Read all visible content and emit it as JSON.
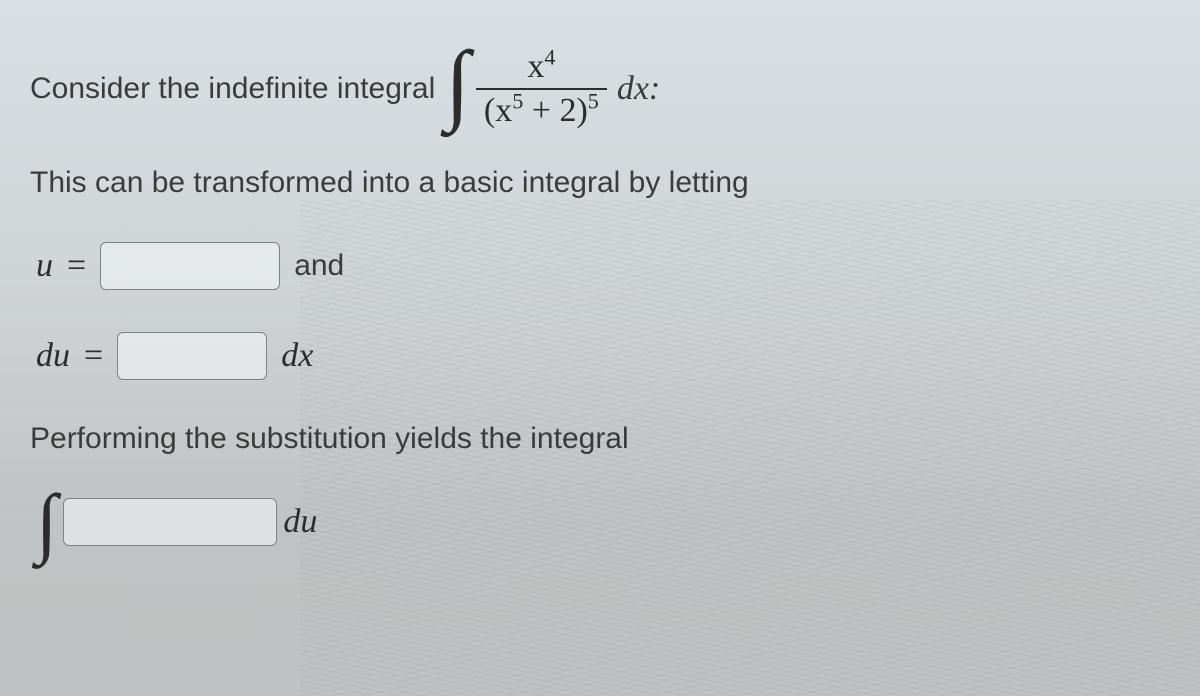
{
  "line1_lead": "Consider the indefinite integral",
  "line1_tail": "dx:",
  "frac_numer_html": "x<sup>4</sup>",
  "frac_denom_html": "(x<sup>5</sup> + 2)<sup>5</sup>",
  "line2": "This can be transformed into a basic integral by letting",
  "u_label": "u",
  "eq_sym": "=",
  "and_label": "and",
  "du_label": "du",
  "dx_label": "dx",
  "line3": "Performing the substitution yields the integral",
  "final_du": "du"
}
